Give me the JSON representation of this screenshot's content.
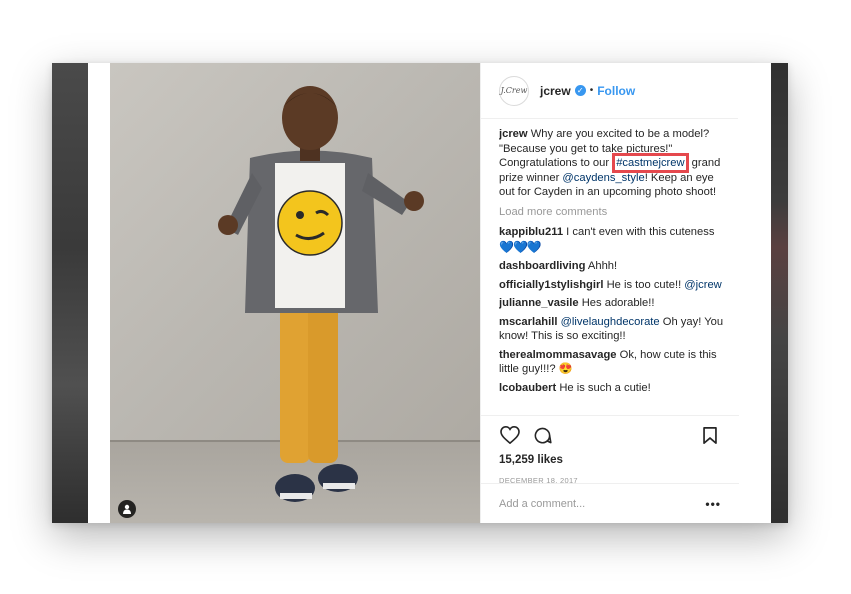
{
  "post": {
    "username": "jcrew",
    "avatar_text": "J.Crew",
    "verified_icon": "verified-badge-icon",
    "separator": "•",
    "follow_label": "Follow",
    "caption": {
      "user": "jcrew",
      "text_1": "Why are you excited to be a model? \"Because you get to take pictures!\" Congratulations to our ",
      "hashtag": "#castmejcrew",
      "text_2": " grand prize winner ",
      "mention": "@caydens_style",
      "text_3": "! Keep an eye out for Cayden in an upcoming photo shoot!"
    },
    "load_more": "Load more comments",
    "comments": [
      {
        "user": "kappiblu211",
        "text": "I can't even with this cuteness",
        "emoji": "💙💙💙"
      },
      {
        "user": "dashboardliving",
        "text": "Ahhh!"
      },
      {
        "user": "officially1stylishgirl",
        "text": "He is too cute!! ",
        "mention": "@jcrew"
      },
      {
        "user": "julianne_vasile",
        "text": "Hes adorable!!"
      },
      {
        "user": "mscarlahill",
        "mention": "@livelaughdecorate",
        "text": " Oh yay! You know! This is so exciting!!"
      },
      {
        "user": "therealmommasavage",
        "text": "Ok, how cute is this little guy!!!? 😍"
      },
      {
        "user": "lcobaubert",
        "text": "He is such a cutie!"
      }
    ],
    "likes": "15,259 likes",
    "date": "December 18, 2017",
    "add_comment_placeholder": "Add a comment...",
    "more_label": "•••"
  },
  "colors": {
    "accent": "#3897f0",
    "highlight_border": "#e5484d",
    "muted_text": "#999999"
  }
}
